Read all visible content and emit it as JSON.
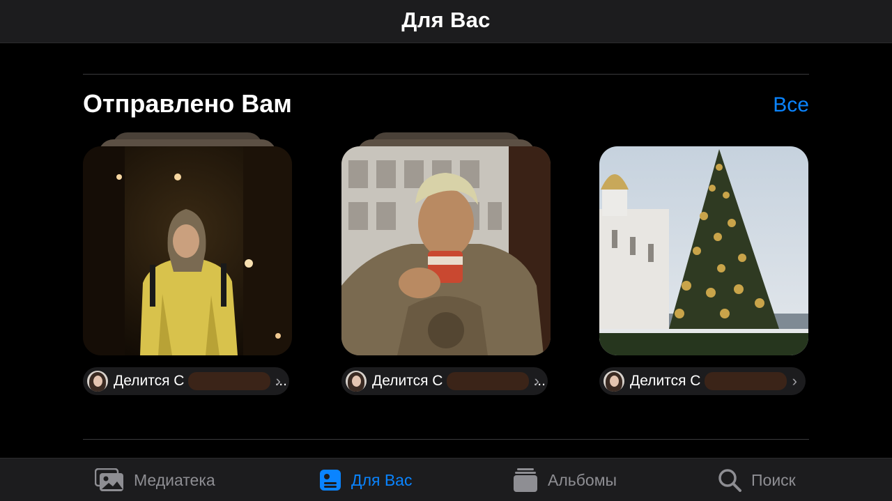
{
  "navbar": {
    "title": "Для Вас"
  },
  "section": {
    "title": "Отправлено Вам",
    "see_all_label": "Все"
  },
  "shared_items": [
    {
      "prefix": "Делится С",
      "ellipsis": "..."
    },
    {
      "prefix": "Делится С",
      "ellipsis": "..."
    },
    {
      "prefix": "Делится С",
      "ellipsis": ""
    }
  ],
  "tabbar": {
    "tabs": [
      {
        "label": "Медиатека",
        "icon": "photo-library-icon",
        "active": false
      },
      {
        "label": "Для Вас",
        "icon": "for-you-icon",
        "active": true
      },
      {
        "label": "Альбомы",
        "icon": "albums-icon",
        "active": false
      },
      {
        "label": "Поиск",
        "icon": "search-icon",
        "active": false
      }
    ]
  },
  "colors": {
    "accent": "#0a84ff",
    "inactive": "#8e8e93",
    "bar_bg": "#1c1c1e",
    "page_bg": "#000000"
  }
}
